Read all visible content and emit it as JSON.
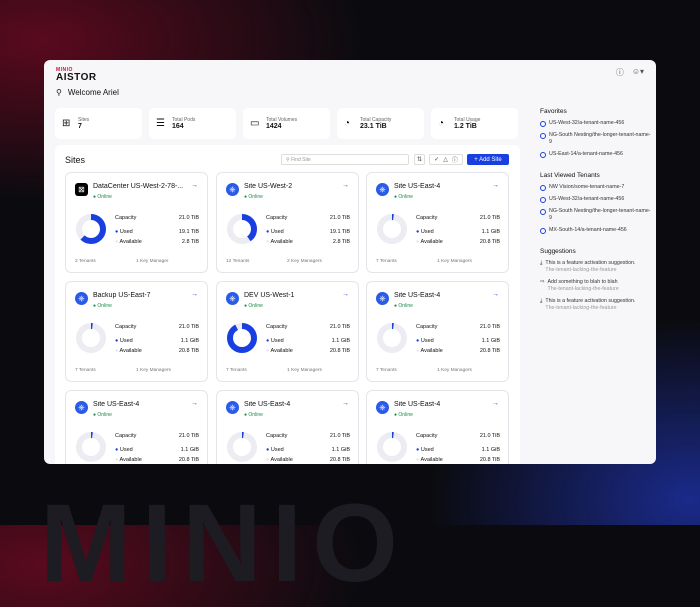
{
  "bg_word": "MINIO",
  "logo": {
    "top": "MINIO",
    "main": "AISTOR"
  },
  "header": {
    "welcome": "Welcome Ariel"
  },
  "stats": [
    {
      "icon": "sites-icon",
      "label": "Sites",
      "value": "7"
    },
    {
      "icon": "database-icon",
      "label": "Total Pods",
      "value": "164"
    },
    {
      "icon": "drive-icon",
      "label": "Total Volumes",
      "value": "1424"
    },
    {
      "icon": "pie-icon",
      "label": "Total Capacity",
      "value": "23.1 TiB"
    },
    {
      "icon": "pie-icon",
      "label": "Total Usage",
      "value": "1.2 TiB"
    }
  ],
  "sites": {
    "title": "Sites",
    "search_placeholder": "Find Site",
    "add_label": "+ Add Site",
    "capacity_label": "Capacity",
    "used_label": "Used",
    "available_label": "Available",
    "status": "Online",
    "cards": [
      {
        "name": "DataCenter US-West-2-78-...",
        "icon": "datacenter",
        "capacity": "21.0 TiB",
        "used": "19.1 TiB",
        "available": "2.8 TiB",
        "used_fraction": 0.62,
        "tenants": "2 Tenants",
        "keys": "1 Key Manager"
      },
      {
        "name": "Site US-West-2",
        "icon": "k8s",
        "capacity": "21.0 TiB",
        "used": "19.1 TiB",
        "available": "2.8 TiB",
        "used_fraction": 0.4,
        "tenants": "12 Tenants",
        "keys": "2 Key Managers"
      },
      {
        "name": "Site US-East-4",
        "icon": "k8s",
        "capacity": "21.0 TiB",
        "used": "1.1 GiB",
        "available": "20.8 TiB",
        "used_fraction": 0.02,
        "tenants": "7 Tenants",
        "keys": "1 Key Managers"
      },
      {
        "name": "Backup US-East-7",
        "icon": "k8s",
        "capacity": "21.0 TiB",
        "used": "1.1 GiB",
        "available": "20.8 TiB",
        "used_fraction": 0.02,
        "tenants": "7 Tenants",
        "keys": "1 Key Managers"
      },
      {
        "name": "DEV US-West-1",
        "icon": "k8s",
        "capacity": "21.0 TiB",
        "used": "1.1 GiB",
        "available": "20.8 TiB",
        "used_fraction": 0.92,
        "tenants": "7 Tenants",
        "keys": "1 Key Managers"
      },
      {
        "name": "Site US-East-4",
        "icon": "k8s",
        "capacity": "21.0 TiB",
        "used": "1.1 GiB",
        "available": "20.8 TiB",
        "used_fraction": 0.02,
        "tenants": "7 Tenants",
        "keys": "1 Key Managers"
      },
      {
        "name": "Site US-East-4",
        "icon": "k8s",
        "capacity": "21.0 TiB",
        "used": "1.1 GiB",
        "available": "20.8 TiB",
        "used_fraction": 0.02,
        "tenants": "",
        "keys": ""
      },
      {
        "name": "Site US-East-4",
        "icon": "k8s",
        "capacity": "21.0 TiB",
        "used": "1.1 GiB",
        "available": "20.8 TiB",
        "used_fraction": 0.02,
        "tenants": "",
        "keys": ""
      },
      {
        "name": "Site US-East-4",
        "icon": "k8s",
        "capacity": "21.0 TiB",
        "used": "1.1 GiB",
        "available": "20.8 TiB",
        "used_fraction": 0.02,
        "tenants": "",
        "keys": ""
      }
    ]
  },
  "sidebar": {
    "favorites_title": "Favorites",
    "favorites": [
      "US-West-32/a-tenant-name-456",
      "NG-South Nesting/the-longer-tenant-name-9",
      "US-East-14/a-tenant-name-456"
    ],
    "recent_title": "Last Viewed Tenants",
    "recent": [
      "NW Vision/some-tenant-name-7",
      "US-West-32/a-tenant-name-456",
      "NG-South Nesting/the-longer-tenant-name-9",
      "MX-South-14/a-tenant-name-456"
    ],
    "suggestions_title": "Suggestions",
    "suggestions": [
      {
        "text": "This is a feature activation suggestion.",
        "sub": "The-tenant-lacking-the-feature"
      },
      {
        "text": "Add something to blah to blah",
        "sub": "The-tenant-lacking-the-feature"
      },
      {
        "text": "This is a feature activation suggestion.",
        "sub": "The-tenant-lacking-the-feature"
      }
    ]
  },
  "colors": {
    "accent": "#1a3fe0",
    "online": "#1a8a4a"
  }
}
